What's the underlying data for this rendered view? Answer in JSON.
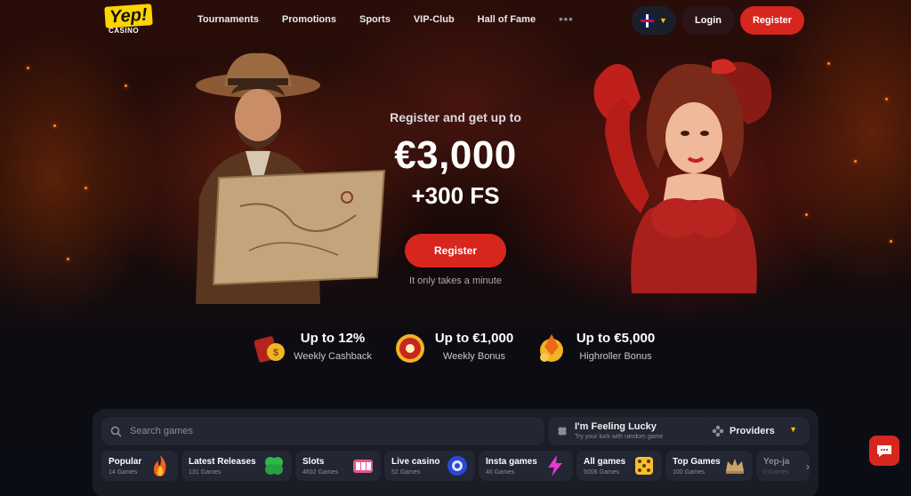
{
  "header": {
    "logo": {
      "text": "Yep!",
      "sub": "CASINO"
    },
    "nav": [
      "Tournaments",
      "Promotions",
      "Sports",
      "VIP-Club",
      "Hall of Fame"
    ],
    "nav_more": "•••",
    "login_label": "Login",
    "register_label": "Register"
  },
  "hero": {
    "subtitle": "Register and get up to",
    "amount": "€3,000",
    "free_spins": "+300 FS",
    "register_label": "Register",
    "note": "It only takes a minute"
  },
  "benefits": [
    {
      "title": "Up to 12%",
      "subtitle": "Weekly Cashback",
      "icon": "cashback-icon"
    },
    {
      "title": "Up to €1,000",
      "subtitle": "Weekly Bonus",
      "icon": "bonus-wheel-icon"
    },
    {
      "title": "Up to €5,000",
      "subtitle": "Highroller Bonus",
      "icon": "highroller-icon"
    }
  ],
  "gamebar": {
    "search_placeholder": "Search games",
    "lucky_title": "I'm Feeling Lucky",
    "lucky_subtitle": "Try your luck with random game",
    "providers_label": "Providers",
    "categories": [
      {
        "name": "Popular",
        "count": "14 Games",
        "icon": "flame-icon"
      },
      {
        "name": "Latest Releases",
        "count": "131 Games",
        "icon": "clover-icon"
      },
      {
        "name": "Slots",
        "count": "4602 Games",
        "icon": "slot-machine-icon"
      },
      {
        "name": "Live casino",
        "count": "52 Games",
        "icon": "poker-chip-icon"
      },
      {
        "name": "Insta games",
        "count": "46 Games",
        "icon": "lightning-icon"
      },
      {
        "name": "All games",
        "count": "5008 Games",
        "icon": "dice-icon"
      },
      {
        "name": "Top Games",
        "count": "100 Games",
        "icon": "crown-icon"
      },
      {
        "name": "Yep-ja",
        "count": "0 Games",
        "icon": "none"
      }
    ]
  },
  "colors": {
    "accent": "#d7261e",
    "brand_yellow": "#ffd400",
    "panel": "#1a1c26"
  }
}
